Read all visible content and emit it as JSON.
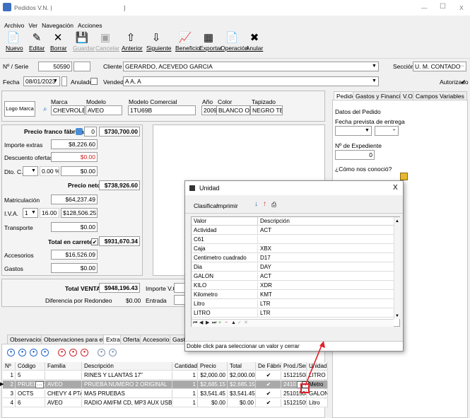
{
  "window": {
    "title": "Pedidos V.N. |",
    "bracket": "]",
    "min": "—",
    "max": "☐",
    "close": "X"
  },
  "menu": [
    "Archivo",
    "Ver",
    "Navegación",
    "Acciones"
  ],
  "toolbar": [
    {
      "label": "Nuevo",
      "icon": "📄",
      "enabled": true
    },
    {
      "label": "Editar",
      "icon": "✎",
      "enabled": true
    },
    {
      "label": "Borrar",
      "icon": "✕",
      "enabled": true
    },
    {
      "label": "Guardar",
      "icon": "💾",
      "enabled": false
    },
    {
      "label": "Cancelar",
      "icon": "▣",
      "enabled": false
    },
    {
      "label": "Anterior",
      "icon": "⇧",
      "enabled": true
    },
    {
      "label": "Siguiente",
      "icon": "⇩",
      "enabled": true
    },
    {
      "label": "Beneficio",
      "icon": "📈",
      "enabled": true
    },
    {
      "label": "Exportar",
      "icon": "▦",
      "enabled": true
    },
    {
      "label": "Operación",
      "icon": "📄",
      "enabled": true
    },
    {
      "label": "Anular",
      "icon": "✖",
      "enabled": true
    }
  ],
  "header": {
    "serie_label": "Nº / Serie",
    "serie_value": "50590",
    "cliente_label": "Cliente",
    "cliente_value": "GERARDO, ACEVEDO GARCIA",
    "seccion_label": "Sección",
    "seccion_value": "U. M. CONTADO",
    "fecha_label": "Fecha",
    "fecha_value": "08/01/2023",
    "anulado_label": "Anulado",
    "vendedor_label": "Vendedor",
    "vendedor_value": "A A, A",
    "autorizado_label": "Autorizado",
    "autorizado_check": "✔"
  },
  "vehicle": {
    "logo": "Logo Marca",
    "marca_label": "Marca",
    "marca_value": "CHEVROLET",
    "modelo_label": "Modelo",
    "modelo_value": "AVEO",
    "modelo_com_label": "Modelo Comercial",
    "modelo_com_value": "1TU69B",
    "anio_label": "Año",
    "anio_value": "2009",
    "color_label": "Color",
    "color_value": "BLANCO OLIMP",
    "tapizado_label": "Tapizado",
    "tapizado_value": "NEGRO TELA"
  },
  "prices": {
    "franco_label": "Precio franco fábrica",
    "franco_qty": "0",
    "franco_value": "$730,700.00",
    "extras_label": "Importe extras",
    "extras_value": "$8,226.60",
    "descuento_label": "Descuento ofertas",
    "descuento_value": "$0.00",
    "dto_label": "Dto. C.",
    "dto_pct": "0.00 %",
    "dto_value": "$0.00",
    "neto_label": "Precio neto",
    "neto_value": "$738,926.60",
    "matric_label": "Matriculación",
    "matric_value": "$64,237.49",
    "iva_label": "I.V.A.",
    "iva_sel": "1",
    "iva_pct": "16.00 %",
    "iva_value": "$128,506.25",
    "transporte_label": "Transporte",
    "transporte_value": "$0.00",
    "carretera_label": "Total en carretera",
    "carretera_check": "✔",
    "carretera_value": "$931,670.34",
    "accesorios_label": "Accesorios",
    "accesorios_value": "$16,526.09",
    "gastos_label": "Gastos",
    "gastos_value": "$0.00",
    "venta_label": "Total VENTA",
    "venta_value": "$948,196.43",
    "redondeo_label": "Diferencia por Redondeo",
    "redondeo_value": "$0.00",
    "importe_vo_label": "Importe V.O.",
    "entrada_label": "Entrada"
  },
  "right_tabs": [
    "Pedido",
    "Gastos y Financiación",
    "V.O.",
    "Campos Variables"
  ],
  "right_panel": {
    "datos_label": "Datos del Pedido",
    "fecha_entrega_label": "Fecha prevista de entrega",
    "expediente_label": "Nº de Expediente",
    "expediente_value": "0",
    "conocio_label": "¿Cómo nos conoció?"
  },
  "bottom_tabs": [
    "Observaciones",
    "Observaciones para el Taller",
    "Extras",
    "Ofertas",
    "Accesorios",
    "Gastos"
  ],
  "circle_buttons": [
    {
      "color": "#2466c8",
      "glyph": "●"
    },
    {
      "color": "#2466c8",
      "glyph": "●"
    },
    {
      "color": "#2466c8",
      "glyph": "●"
    },
    {
      "color": "#2466c8",
      "glyph": "●"
    },
    {
      "color": "#c8282e",
      "glyph": "●"
    },
    {
      "color": "#c8282e",
      "glyph": "●"
    },
    {
      "color": "#c8282e",
      "glyph": "●"
    },
    {
      "color": "#7d93b0",
      "glyph": "●"
    },
    {
      "color": "#7d93b0",
      "glyph": "●"
    }
  ],
  "extras_grid": {
    "headers": [
      "Nº",
      "Código",
      "Familia",
      "Descripción",
      "Cantidad",
      "Precio",
      "Total",
      "De Fábrica",
      "Prod./Serv.",
      "Unidad"
    ],
    "rows": [
      {
        "n": "1",
        "codigo": "5",
        "familia": "",
        "desc": "RINES Y LLANTAS 17\"",
        "cant": "1",
        "precio": "$2,000.00",
        "total": "$2,000.00",
        "fab": "✔",
        "prod": "15121508",
        "unidad": "LITRO",
        "sel": false
      },
      {
        "n": "2",
        "codigo": "PRUEBAS",
        "familia": "AVEO",
        "desc": "PRUEBA NUMERO 2 ORIGINAL",
        "cant": "1",
        "precio": "$2,685.15",
        "total": "$2,685.15",
        "fab": "✔",
        "prod": "24101510",
        "unidad": "Metro",
        "sel": true
      },
      {
        "n": "3",
        "codigo": "OCTS",
        "familia": "CHEVY 4 PTAS",
        "desc": "MAS PRUEBAS",
        "cant": "1",
        "precio": "$3,541.45",
        "total": "$3,541.45",
        "fab": "✔",
        "prod": "25101503",
        "unidad": "GALON",
        "sel": false
      },
      {
        "n": "4",
        "codigo": "6",
        "familia": "AVEO",
        "desc": "RADIO AM/FM CD, MP3 AUX USB",
        "cant": "1",
        "precio": "$0.00",
        "total": "$0.00",
        "fab": "✔",
        "prod": "15121509",
        "unidad": "Litro",
        "sel": false
      }
    ],
    "ellipsis": "···"
  },
  "popup": {
    "title": "Unidad",
    "close": "X",
    "clasificar": "Clasificar",
    "imprimir": "Imprimir",
    "col_valor": "Valor",
    "col_desc": "Descripción",
    "rows": [
      {
        "valor": "Actividad",
        "desc": "ACT"
      },
      {
        "valor": "C61",
        "desc": ""
      },
      {
        "valor": "Caja",
        "desc": "XBX"
      },
      {
        "valor": "Centimetro cuadrado",
        "desc": "D17"
      },
      {
        "valor": "Dia",
        "desc": "DAY"
      },
      {
        "valor": "GALON",
        "desc": "ACT"
      },
      {
        "valor": "KILO",
        "desc": "XDR"
      },
      {
        "valor": "Kilometro",
        "desc": "KMT"
      },
      {
        "valor": "Litro",
        "desc": "LTR"
      },
      {
        "valor": "LITRO",
        "desc": "LTR"
      }
    ],
    "nav": [
      "⏮",
      "◀",
      "▶",
      "⏭",
      "+",
      "−",
      "▲",
      "✓",
      "✕"
    ],
    "status": "Doble click para seleccionar un valor y cerrar"
  },
  "annotation_color": "#e0202a"
}
